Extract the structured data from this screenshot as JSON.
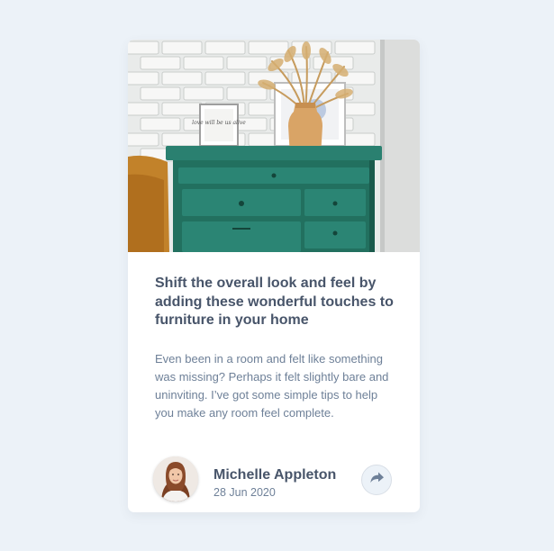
{
  "article": {
    "title": "Shift the overall look and feel by adding these wonderful touches to furniture in your home",
    "excerpt": "Even been in a room and felt like something was missing? Perhaps it felt slightly bare and uninviting. I’ve got some simple tips to help you make any room feel complete.",
    "hero_image": "drawers-photo",
    "frame_text": "love will be us alive"
  },
  "author": {
    "name": "Michelle Appleton",
    "date": "28 Jun 2020",
    "avatar": "avatar-photo"
  },
  "share": {
    "icon": "share-icon"
  },
  "colors": {
    "background": "#ECF2F8",
    "card": "#FFFFFF",
    "title": "#48556A",
    "text": "#6E8098",
    "share_button_bg": "#ECF2F8",
    "share_icon": "#6E8098"
  }
}
